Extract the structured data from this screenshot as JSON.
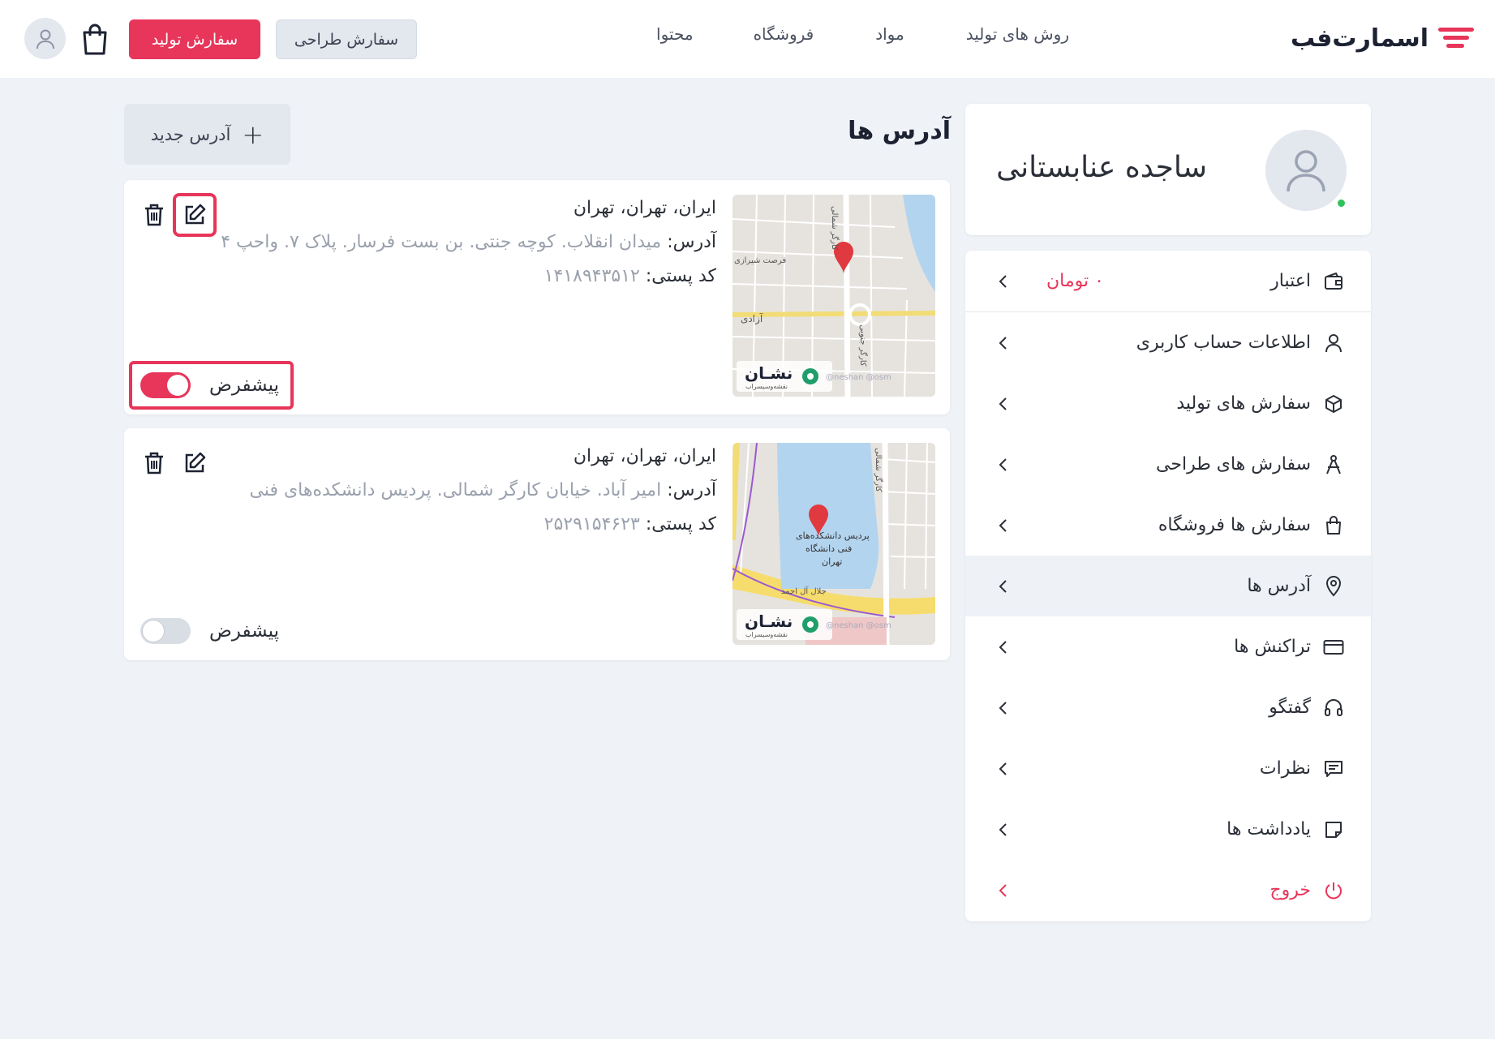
{
  "header": {
    "logo_text": "اسمارت‌فب",
    "nav": [
      "روش های تولید",
      "مواد",
      "فروشگاه",
      "محتوا"
    ],
    "design_order_label": "سفارش طراحی",
    "production_order_label": "سفارش تولید"
  },
  "profile": {
    "name": "ساجده عنابستانی"
  },
  "menu": {
    "items": [
      {
        "label": "اعتبار",
        "icon": "wallet-icon",
        "extra": "۰ تومان"
      },
      {
        "label": "اطلاعات حساب کاربری",
        "icon": "user-icon"
      },
      {
        "label": "سفارش های تولید",
        "icon": "box-icon"
      },
      {
        "label": "سفارش های طراحی",
        "icon": "compass-icon"
      },
      {
        "label": "سفارش ها فروشگاه",
        "icon": "shopping-bag-icon"
      },
      {
        "label": "آدرس ها",
        "icon": "location-pin-icon",
        "active": true
      },
      {
        "label": "تراکنش ها",
        "icon": "credit-card-icon"
      },
      {
        "label": "گفتگو",
        "icon": "headset-icon"
      },
      {
        "label": "نظرات",
        "icon": "comment-icon"
      },
      {
        "label": "یادداشت ها",
        "icon": "note-icon"
      },
      {
        "label": "خروج",
        "icon": "power-icon"
      }
    ]
  },
  "main": {
    "title": "آدرس ها",
    "new_address_label": "آدرس جدید",
    "default_label": "پیشفرض",
    "address_label": "آدرس:",
    "postal_label": "کد پستی:",
    "map_brand": "نشـان",
    "map_brand_sub": "نقشه‌وسیسراب",
    "addresses": [
      {
        "region": "ایران، تهران، تهران",
        "address": "میدان انقلاب. کوچه جنتی. بن بست فرسار. پلاک ۷. واحپ ۴",
        "postal": "۱۴۱۸۹۴۳۵۱۲",
        "is_default": true,
        "map_labels": [
          "فرصت شیرازی",
          "آزادی",
          "کارگر شمالی",
          "کارگر جنوبی",
          "@neshan @osm"
        ]
      },
      {
        "region": "ایران، تهران، تهران",
        "address": "امیر آباد. خیابان کارگر شمالی. پردیس دانشکده‌های فنی",
        "postal": "۲۵۲۹۱۵۴۶۲۳",
        "is_default": false,
        "map_labels": [
          "پردیس دانشکده‌های",
          "فنی دانشگاه",
          "تهران",
          "کارگر شمالی",
          "جلال آل احمد",
          "@neshan @osm"
        ]
      }
    ]
  }
}
